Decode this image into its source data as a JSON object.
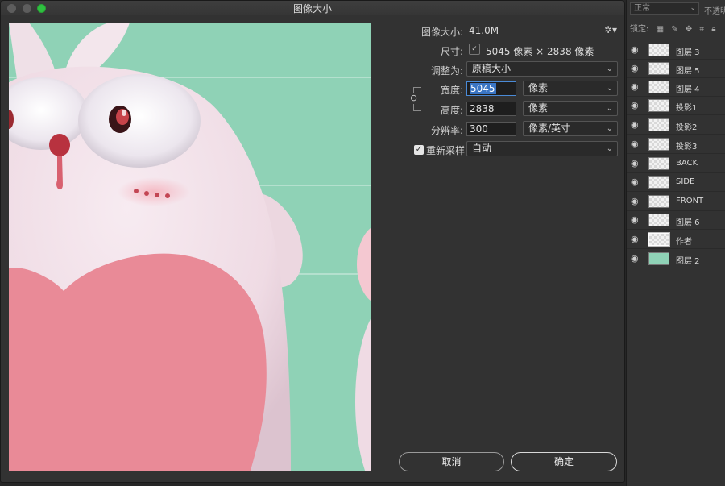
{
  "dialog": {
    "title": "图像大小",
    "image_size_label": "图像大小:",
    "image_size_value": "41.0M",
    "dimensions_label": "尺寸:",
    "dimensions_value": "5045 像素  ×  2838 像素",
    "fit_to_label": "调整为:",
    "fit_to_value": "原稿大小",
    "width_label": "宽度:",
    "width_value": "5045",
    "width_unit": "像素",
    "height_label": "高度:",
    "height_value": "2838",
    "height_unit": "像素",
    "resolution_label": "分辨率:",
    "resolution_value": "300",
    "resolution_unit": "像素/英寸",
    "resample_label": "重新采样:",
    "resample_value": "自动",
    "cancel_label": "取消",
    "ok_label": "确定"
  },
  "layers_panel": {
    "blend_mode": "正常",
    "opacity_label": "不透明",
    "lock_label": "锁定:",
    "layers": [
      {
        "name": "图层 3"
      },
      {
        "name": "图层 5"
      },
      {
        "name": "图层 4"
      },
      {
        "name": "投影1"
      },
      {
        "name": "投影2"
      },
      {
        "name": "投影3"
      },
      {
        "name": "BACK"
      },
      {
        "name": "SIDE"
      },
      {
        "name": "FRONT"
      },
      {
        "name": "图层 6"
      },
      {
        "name": "作者"
      },
      {
        "name": "图层 2"
      }
    ]
  },
  "colors": {
    "preview_background": "#8fd2b6",
    "rabbit_body": "#f1dee6",
    "heart": "#e98a97",
    "nose": "#b8323f",
    "accent_blue": "#3a75c4"
  },
  "icons": {
    "eye": "eye-icon",
    "gear": "gear-icon",
    "link": "link-icon",
    "chevron": "chevron-down-icon"
  }
}
